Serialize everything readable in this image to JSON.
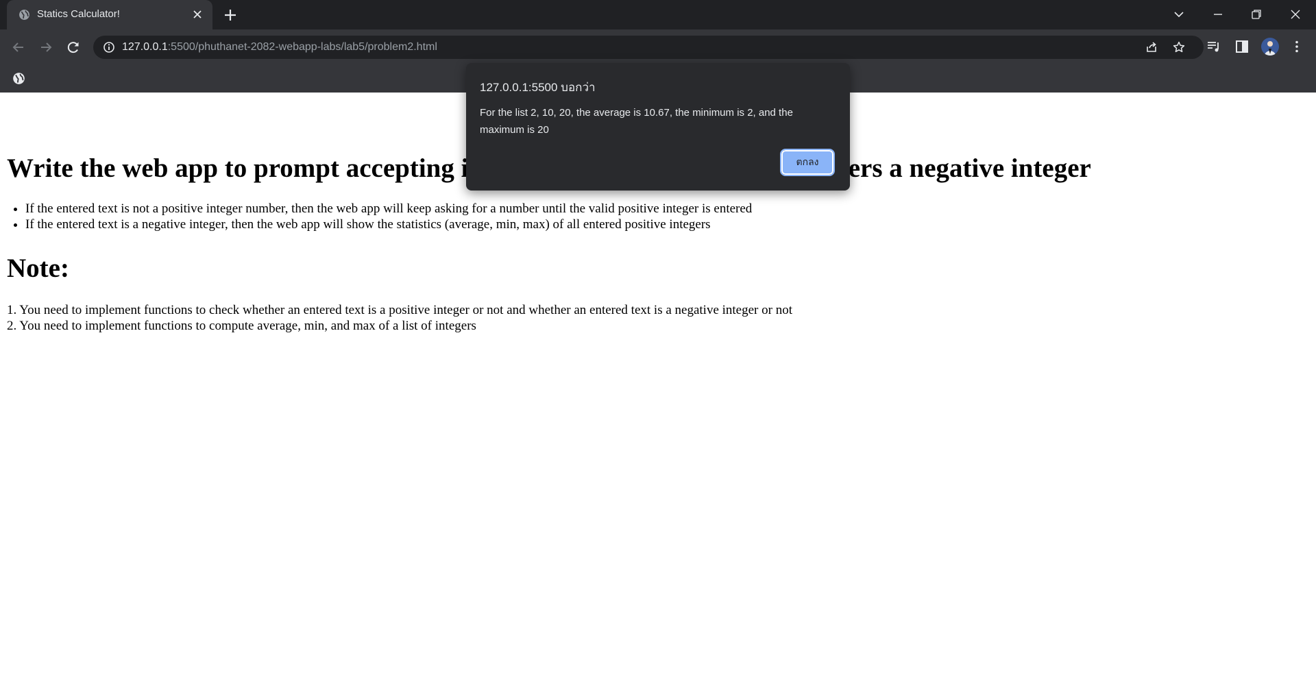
{
  "browser": {
    "tab": {
      "title": "Statics Calculator!"
    },
    "address": {
      "host": "127.0.0.1",
      "rest": ":5500/phuthanet-2082-webapp-labs/lab5/problem2.html"
    }
  },
  "page": {
    "heading": "Write the web app to prompt accepting integer numbers until the user enters a negative integer",
    "rules": [
      "If the entered text is not a positive integer number, then the web app will keep asking for a number until the valid positive integer is entered",
      "If the entered text is a negative integer, then the web app will show the statistics (average, min, max) of all entered positive integers"
    ],
    "note_heading": "Note:",
    "notes": [
      "1. You need to implement functions to check whether an entered text is a positive integer or not and whether an entered text is a negative integer or not",
      "2. You need to implement functions to compute average, min, and max of a list of integers"
    ]
  },
  "dialog": {
    "origin": "127.0.0.1:5500 บอกว่า",
    "message": "For the list 2, 10, 20, the average is 10.67, the minimum is 2, and the maximum is 20",
    "ok_label": "ตกลง"
  },
  "icons": {
    "favicon": "globe-icon",
    "tab_close": "close-icon",
    "new_tab": "plus-icon",
    "back": "arrow-left-icon",
    "forward": "arrow-right-icon",
    "reload": "reload-icon",
    "site_info": "info-icon",
    "share": "share-icon",
    "bookmark": "star-icon",
    "media": "media-queue-icon",
    "side_panel": "side-panel-icon",
    "menu": "kebab-menu-icon"
  },
  "colors": {
    "chrome_dark": "#202124",
    "chrome_toolbar": "#35363a",
    "dialog_bg": "#292a2d",
    "dialog_button": "#8ab4f8"
  }
}
